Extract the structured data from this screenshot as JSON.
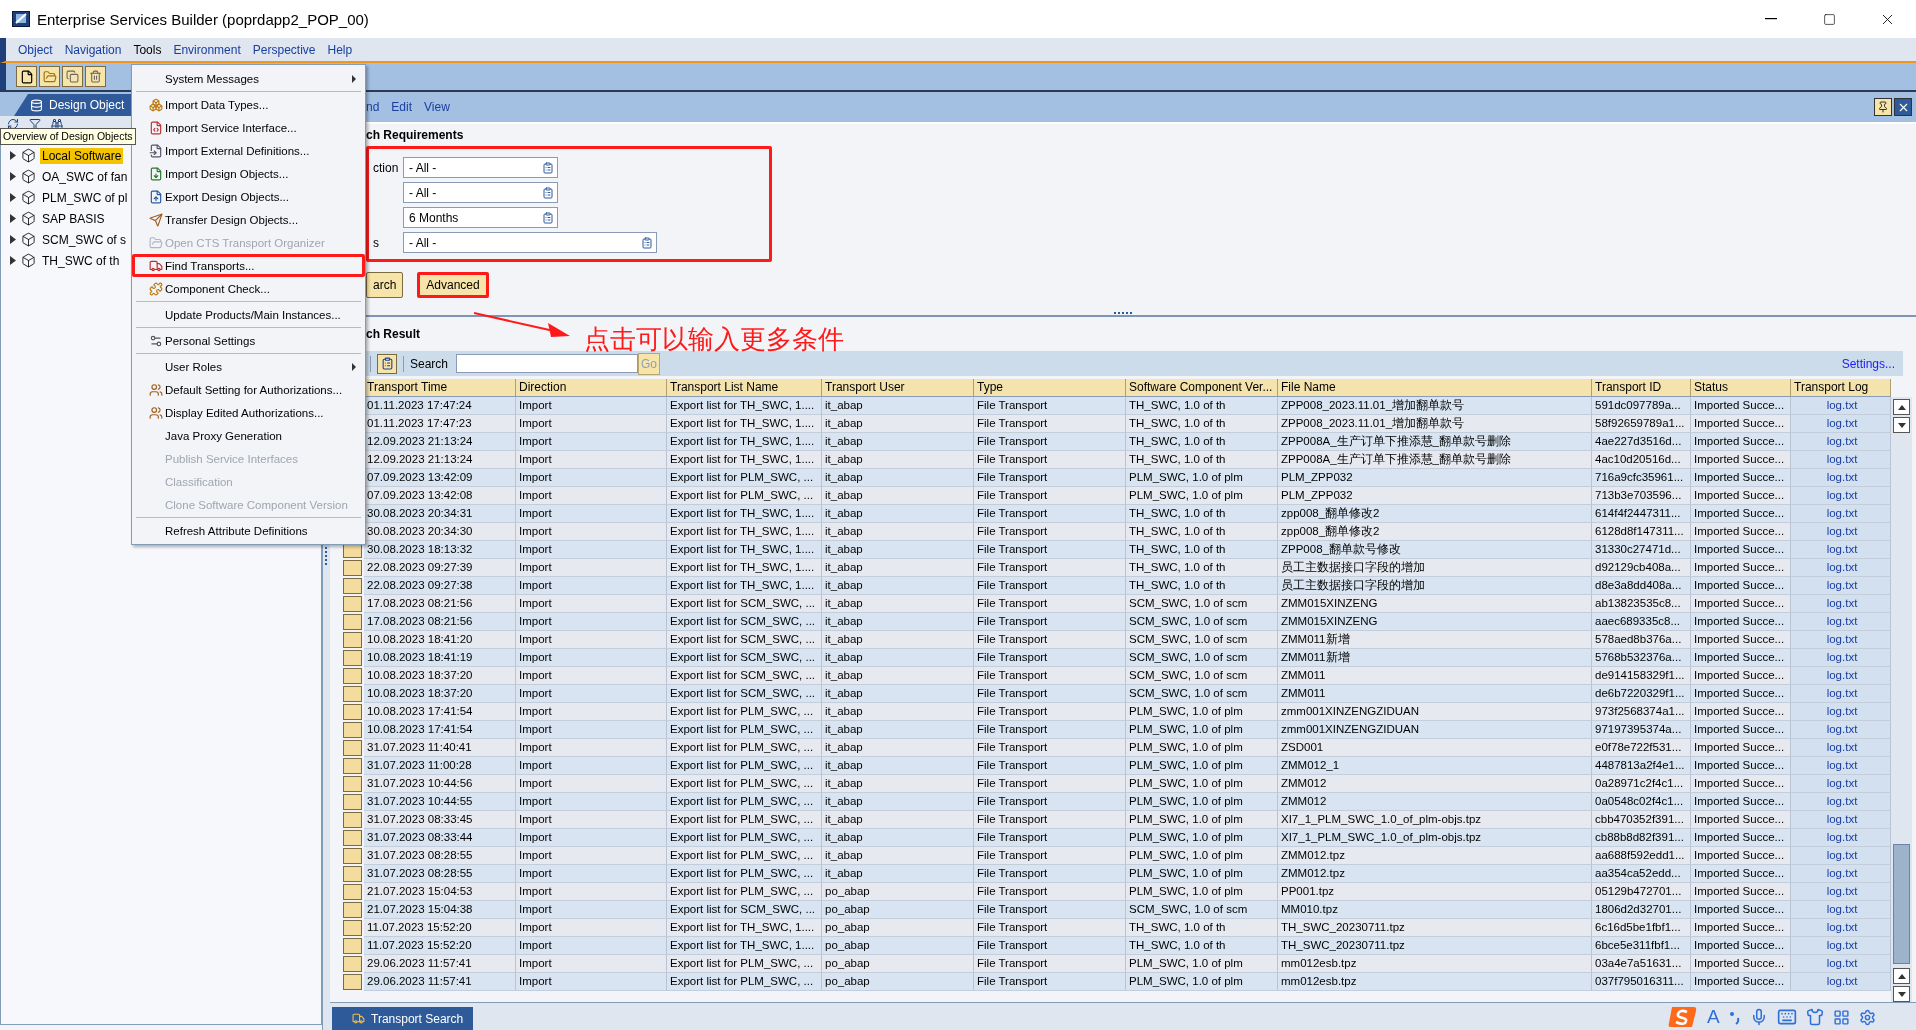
{
  "window": {
    "title": "Enterprise Services Builder (poprdapp2_POP_00)"
  },
  "menu_bar": [
    {
      "label": "Object",
      "selected": false
    },
    {
      "label": "Navigation",
      "selected": false
    },
    {
      "label": "Tools",
      "selected": true
    },
    {
      "label": "Environment",
      "selected": false
    },
    {
      "label": "Perspective",
      "selected": false
    },
    {
      "label": "Help",
      "selected": false
    }
  ],
  "tools_menu": {
    "items": [
      {
        "kind": "submenu",
        "label": "System Messages",
        "disabled": false,
        "marked": false
      },
      {
        "kind": "separator"
      },
      {
        "kind": "icon",
        "label": "Import Data Types...",
        "disabled": false,
        "marked": false
      },
      {
        "kind": "icon",
        "label": "Import Service Interface...",
        "disabled": false,
        "marked": false
      },
      {
        "kind": "icon",
        "label": "Import External Definitions...",
        "disabled": false,
        "marked": false
      },
      {
        "kind": "icon",
        "label": "Import Design Objects...",
        "disabled": false,
        "marked": false
      },
      {
        "kind": "icon",
        "label": "Export Design Objects...",
        "disabled": false,
        "marked": false
      },
      {
        "kind": "icon",
        "label": "Transfer Design Objects...",
        "disabled": false,
        "marked": false
      },
      {
        "kind": "icon",
        "label": "Open CTS Transport Organizer",
        "disabled": true,
        "marked": false
      },
      {
        "kind": "icon",
        "label": "Find Transports...",
        "disabled": false,
        "marked": true
      },
      {
        "kind": "icon",
        "label": "Component Check...",
        "disabled": false,
        "marked": false
      },
      {
        "kind": "separator"
      },
      {
        "kind": "plain",
        "label": "Update Products/Main Instances...",
        "disabled": false,
        "marked": false
      },
      {
        "kind": "separator"
      },
      {
        "kind": "icon",
        "label": "Personal Settings",
        "disabled": false,
        "marked": false
      },
      {
        "kind": "separator"
      },
      {
        "kind": "submenu",
        "label": "User Roles",
        "disabled": false,
        "marked": false
      },
      {
        "kind": "icon",
        "label": "Default Setting for Authorizations...",
        "disabled": false,
        "marked": false
      },
      {
        "kind": "icon",
        "label": "Display Edited Authorizations...",
        "disabled": false,
        "marked": false
      },
      {
        "kind": "plain",
        "label": "Java Proxy Generation",
        "disabled": false,
        "marked": false
      },
      {
        "kind": "plain",
        "label": "Publish Service Interfaces",
        "disabled": true,
        "marked": false
      },
      {
        "kind": "plain",
        "label": "Classification",
        "disabled": true,
        "marked": false
      },
      {
        "kind": "plain",
        "label": "Clone Software Component Version",
        "disabled": true,
        "marked": false
      },
      {
        "kind": "separator"
      },
      {
        "kind": "plain",
        "label": "Refresh Attribute Definitions",
        "disabled": false,
        "marked": false
      }
    ]
  },
  "navigator": {
    "tab": "Design Object",
    "tooltip": "Overview of Design Objects",
    "tree": [
      {
        "label": "Local Software",
        "selected": true,
        "expanded": false
      },
      {
        "label": "OA_SWC of fan",
        "selected": false,
        "expanded": false
      },
      {
        "label": "PLM_SWC of pl",
        "selected": false,
        "expanded": false
      },
      {
        "label": "SAP BASIS",
        "selected": false,
        "expanded": false
      },
      {
        "label": "SCM_SWC of s",
        "selected": false,
        "expanded": false
      },
      {
        "label": "TH_SWC of th",
        "selected": false,
        "expanded": false
      }
    ]
  },
  "editor": {
    "menu": [
      "nd",
      "Edit",
      "View"
    ],
    "requirements": {
      "title": "ch Requirements",
      "marked": true,
      "fields": [
        {
          "label": "ction",
          "value": "- All -",
          "kind": "normal"
        },
        {
          "value": "- All -",
          "kind": "normal"
        },
        {
          "value": "6 Months",
          "kind": "normal"
        },
        {
          "label": "s",
          "value": "- All -",
          "kind": "wide"
        }
      ]
    },
    "buttons": [
      {
        "label": "arch",
        "marked": false
      },
      {
        "label": "Advanced",
        "marked": true
      }
    ],
    "result": {
      "title": "ch Result",
      "search_label": "Search",
      "go": {
        "label": "Go",
        "disabled": true
      },
      "settings": "Settings...",
      "columns": [
        {
          "label": "Transport Time",
          "kind": "text"
        },
        {
          "label": "Direction",
          "kind": "text"
        },
        {
          "label": "Transport List Name",
          "kind": "text"
        },
        {
          "label": "Transport User",
          "kind": "text"
        },
        {
          "label": "Type",
          "kind": "text"
        },
        {
          "label": "Software Component Ver...",
          "kind": "text"
        },
        {
          "label": "File Name",
          "kind": "text"
        },
        {
          "label": "Transport ID",
          "kind": "text"
        },
        {
          "label": "Status",
          "kind": "text"
        },
        {
          "label": "Transport Log",
          "kind": "link"
        }
      ],
      "rows": [
        {
          "cells": [
            "01.11.2023 17:47:24",
            "Import",
            "Export list for TH_SWC, 1....",
            "it_abap",
            "File Transport",
            "TH_SWC, 1.0 of th",
            "ZPP008_2023.11.01_增加翻单款号",
            "591dc097789a...",
            "Imported Succe...",
            "log.txt"
          ]
        },
        {
          "cells": [
            "01.11.2023 17:47:23",
            "Import",
            "Export list for TH_SWC, 1....",
            "it_abap",
            "File Transport",
            "TH_SWC, 1.0 of th",
            "ZPP008_2023.11.01_增加翻单款号",
            "58f92659789a1...",
            "Imported Succe...",
            "log.txt"
          ]
        },
        {
          "cells": [
            "12.09.2023 21:13:24",
            "Import",
            "Export list for TH_SWC, 1....",
            "it_abap",
            "File Transport",
            "TH_SWC, 1.0 of th",
            "ZPP008A_生产订单下推添慧_翻单款号删除",
            "4ae227d3516d...",
            "Imported Succe...",
            "log.txt"
          ]
        },
        {
          "cells": [
            "12.09.2023 21:13:24",
            "Import",
            "Export list for TH_SWC, 1....",
            "it_abap",
            "File Transport",
            "TH_SWC, 1.0 of th",
            "ZPP008A_生产订单下推添慧_翻单款号删除",
            "4ac10d20516d...",
            "Imported Succe...",
            "log.txt"
          ]
        },
        {
          "cells": [
            "07.09.2023 13:42:09",
            "Import",
            "Export list for PLM_SWC, ...",
            "it_abap",
            "File Transport",
            "PLM_SWC, 1.0 of plm",
            "PLM_ZPP032",
            "716a9cfc35961...",
            "Imported Succe...",
            "log.txt"
          ]
        },
        {
          "cells": [
            "07.09.2023 13:42:08",
            "Import",
            "Export list for PLM_SWC, ...",
            "it_abap",
            "File Transport",
            "PLM_SWC, 1.0 of plm",
            "PLM_ZPP032",
            "713b3e703596...",
            "Imported Succe...",
            "log.txt"
          ]
        },
        {
          "cells": [
            "30.08.2023 20:34:31",
            "Import",
            "Export list for TH_SWC, 1....",
            "it_abap",
            "File Transport",
            "TH_SWC, 1.0 of th",
            "zpp008_翻单修改2",
            "614f4f2447311...",
            "Imported Succe...",
            "log.txt"
          ]
        },
        {
          "cells": [
            "30.08.2023 20:34:30",
            "Import",
            "Export list for TH_SWC, 1....",
            "it_abap",
            "File Transport",
            "TH_SWC, 1.0 of th",
            "zpp008_翻单修改2",
            "6128d8f147311...",
            "Imported Succe...",
            "log.txt"
          ]
        },
        {
          "cells": [
            "30.08.2023 18:13:32",
            "Import",
            "Export list for TH_SWC, 1....",
            "it_abap",
            "File Transport",
            "TH_SWC, 1.0 of th",
            "ZPP008_翻单款号修改",
            "31330c27471d...",
            "Imported Succe...",
            "log.txt"
          ]
        },
        {
          "cells": [
            "22.08.2023 09:27:39",
            "Import",
            "Export list for TH_SWC, 1....",
            "it_abap",
            "File Transport",
            "TH_SWC, 1.0 of th",
            "员工主数据接口字段的增加",
            "d92129cb408a...",
            "Imported Succe...",
            "log.txt"
          ]
        },
        {
          "cells": [
            "22.08.2023 09:27:38",
            "Import",
            "Export list for TH_SWC, 1....",
            "it_abap",
            "File Transport",
            "TH_SWC, 1.0 of th",
            "员工主数据接口字段的增加",
            "d8e3a8dd408a...",
            "Imported Succe...",
            "log.txt"
          ]
        },
        {
          "cells": [
            "17.08.2023 08:21:56",
            "Import",
            "Export list for SCM_SWC, ...",
            "it_abap",
            "File Transport",
            "SCM_SWC, 1.0 of scm",
            "ZMM015XINZENG",
            "ab13823535c8...",
            "Imported Succe...",
            "log.txt"
          ]
        },
        {
          "cells": [
            "17.08.2023 08:21:56",
            "Import",
            "Export list for SCM_SWC, ...",
            "it_abap",
            "File Transport",
            "SCM_SWC, 1.0 of scm",
            "ZMM015XINZENG",
            "aaec689335c8...",
            "Imported Succe...",
            "log.txt"
          ]
        },
        {
          "cells": [
            "10.08.2023 18:41:20",
            "Import",
            "Export list for SCM_SWC, ...",
            "it_abap",
            "File Transport",
            "SCM_SWC, 1.0 of scm",
            "ZMM011新增",
            "578aed8b376a...",
            "Imported Succe...",
            "log.txt"
          ]
        },
        {
          "cells": [
            "10.08.2023 18:41:19",
            "Import",
            "Export list for SCM_SWC, ...",
            "it_abap",
            "File Transport",
            "SCM_SWC, 1.0 of scm",
            "ZMM011新增",
            "5768b532376a...",
            "Imported Succe...",
            "log.txt"
          ]
        },
        {
          "cells": [
            "10.08.2023 18:37:20",
            "Import",
            "Export list for SCM_SWC, ...",
            "it_abap",
            "File Transport",
            "SCM_SWC, 1.0 of scm",
            "ZMM011",
            "de914158329f1...",
            "Imported Succe...",
            "log.txt"
          ]
        },
        {
          "cells": [
            "10.08.2023 18:37:20",
            "Import",
            "Export list for SCM_SWC, ...",
            "it_abap",
            "File Transport",
            "SCM_SWC, 1.0 of scm",
            "ZMM011",
            "de6b7220329f1...",
            "Imported Succe...",
            "log.txt"
          ]
        },
        {
          "cells": [
            "10.08.2023 17:41:54",
            "Import",
            "Export list for PLM_SWC, ...",
            "it_abap",
            "File Transport",
            "PLM_SWC, 1.0 of plm",
            "zmm001XINZENGZIDUAN",
            "973f2568374a1...",
            "Imported Succe...",
            "log.txt"
          ]
        },
        {
          "cells": [
            "10.08.2023 17:41:54",
            "Import",
            "Export list for PLM_SWC, ...",
            "it_abap",
            "File Transport",
            "PLM_SWC, 1.0 of plm",
            "zmm001XINZENGZIDUAN",
            "97197395374a...",
            "Imported Succe...",
            "log.txt"
          ]
        },
        {
          "cells": [
            "31.07.2023 11:40:41",
            "Import",
            "Export list for PLM_SWC, ...",
            "it_abap",
            "File Transport",
            "PLM_SWC, 1.0 of plm",
            "ZSD001",
            "e0f78e722f531...",
            "Imported Succe...",
            "log.txt"
          ]
        },
        {
          "cells": [
            "31.07.2023 11:00:28",
            "Import",
            "Export list for PLM_SWC, ...",
            "it_abap",
            "File Transport",
            "PLM_SWC, 1.0 of plm",
            "ZMM012_1",
            "4487813a2f4e1...",
            "Imported Succe...",
            "log.txt"
          ]
        },
        {
          "cells": [
            "31.07.2023 10:44:56",
            "Import",
            "Export list for PLM_SWC, ...",
            "it_abap",
            "File Transport",
            "PLM_SWC, 1.0 of plm",
            "ZMM012",
            "0a28971c2f4c1...",
            "Imported Succe...",
            "log.txt"
          ]
        },
        {
          "cells": [
            "31.07.2023 10:44:55",
            "Import",
            "Export list for PLM_SWC, ...",
            "it_abap",
            "File Transport",
            "PLM_SWC, 1.0 of plm",
            "ZMM012",
            "0a0548c02f4c1...",
            "Imported Succe...",
            "log.txt"
          ]
        },
        {
          "cells": [
            "31.07.2023 08:33:45",
            "Import",
            "Export list for PLM_SWC, ...",
            "it_abap",
            "File Transport",
            "PLM_SWC, 1.0 of plm",
            "XI7_1_PLM_SWC_1.0_of_plm-objs.tpz",
            "cbb470352f391...",
            "Imported Succe...",
            "log.txt"
          ]
        },
        {
          "cells": [
            "31.07.2023 08:33:44",
            "Import",
            "Export list for PLM_SWC, ...",
            "it_abap",
            "File Transport",
            "PLM_SWC, 1.0 of plm",
            "XI7_1_PLM_SWC_1.0_of_plm-objs.tpz",
            "cb88b8d82f391...",
            "Imported Succe...",
            "log.txt"
          ]
        },
        {
          "cells": [
            "31.07.2023 08:28:55",
            "Import",
            "Export list for PLM_SWC, ...",
            "it_abap",
            "File Transport",
            "PLM_SWC, 1.0 of plm",
            "ZMM012.tpz",
            "aa688f592edd1...",
            "Imported Succe...",
            "log.txt"
          ]
        },
        {
          "cells": [
            "31.07.2023 08:28:55",
            "Import",
            "Export list for PLM_SWC, ...",
            "it_abap",
            "File Transport",
            "PLM_SWC, 1.0 of plm",
            "ZMM012.tpz",
            "aa354ca52edd...",
            "Imported Succe...",
            "log.txt"
          ]
        },
        {
          "cells": [
            "21.07.2023 15:04:53",
            "Import",
            "Export list for PLM_SWC, ...",
            "po_abap",
            "File Transport",
            "PLM_SWC, 1.0 of plm",
            "PP001.tpz",
            "05129b472701...",
            "Imported Succe...",
            "log.txt"
          ]
        },
        {
          "cells": [
            "21.07.2023 15:04:38",
            "Import",
            "Export list for SCM_SWC, ...",
            "po_abap",
            "File Transport",
            "SCM_SWC, 1.0 of scm",
            "MM010.tpz",
            "1806d2d32701...",
            "Imported Succe...",
            "log.txt"
          ]
        },
        {
          "cells": [
            "11.07.2023 15:52:20",
            "Import",
            "Export list for TH_SWC, 1....",
            "po_abap",
            "File Transport",
            "TH_SWC, 1.0 of th",
            "TH_SWC_20230711.tpz",
            "6c16d5be1fbf1...",
            "Imported Succe...",
            "log.txt"
          ]
        },
        {
          "cells": [
            "11.07.2023 15:52:20",
            "Import",
            "Export list for TH_SWC, 1....",
            "po_abap",
            "File Transport",
            "TH_SWC, 1.0 of th",
            "TH_SWC_20230711.tpz",
            "6bce5e311fbf1...",
            "Imported Succe...",
            "log.txt"
          ]
        },
        {
          "cells": [
            "29.06.2023 11:57:41",
            "Import",
            "Export list for PLM_SWC, ...",
            "po_abap",
            "File Transport",
            "PLM_SWC, 1.0 of plm",
            "mm012esb.tpz",
            "03a4e7a51631...",
            "Imported Succe...",
            "log.txt"
          ]
        },
        {
          "cells": [
            "29.06.2023 11:57:41",
            "Import",
            "Export list for PLM_SWC, ...",
            "po_abap",
            "File Transport",
            "PLM_SWC, 1.0 of plm",
            "mm012esb.tpz",
            "037f795016311...",
            "Imported Succe...",
            "log.txt"
          ]
        }
      ]
    },
    "bottom_tab": "Transport Search"
  },
  "annotation": {
    "note": "点击可以输入更多条件"
  },
  "ime_bar": {
    "mode": "A"
  }
}
